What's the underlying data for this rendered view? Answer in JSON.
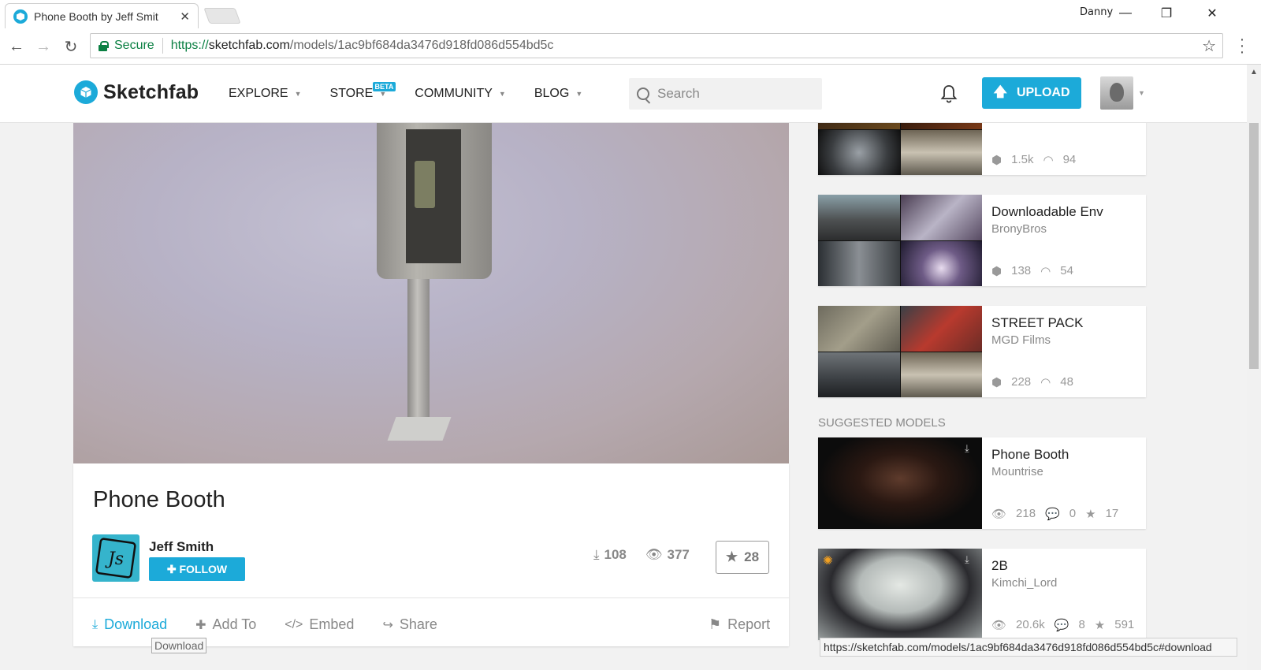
{
  "browser": {
    "tab_title": "Phone Booth by Jeff Smit",
    "window_user": "Danny",
    "secure_label": "Secure",
    "url_scheme": "https://",
    "url_host": "sketchfab.com",
    "url_path": "/models/1ac9bf684da3476d918fd086d554bd5c",
    "status_url": "https://sketchfab.com/models/1ac9bf684da3476d918fd086d554bd5c#download"
  },
  "header": {
    "logo_text": "Sketchfab",
    "nav": [
      {
        "label": "Explore"
      },
      {
        "label": "Store",
        "badge": "BETA"
      },
      {
        "label": "Community"
      },
      {
        "label": "Blog"
      }
    ],
    "search_placeholder": "Search",
    "upload_label": "UPLOAD"
  },
  "model": {
    "title": "Phone Booth",
    "author": "Jeff Smith",
    "follow_label": "FOLLOW",
    "downloads": "108",
    "views": "377",
    "likes": "28",
    "actions": {
      "download": "Download",
      "add_to": "Add To",
      "embed": "Embed",
      "share": "Share",
      "report": "Report"
    },
    "tooltip": "Download"
  },
  "sidebar": {
    "collections": [
      {
        "title": "",
        "author": "",
        "models": "1.5k",
        "followers": "94"
      },
      {
        "title": "Downloadable Env",
        "author": "BronyBros",
        "models": "138",
        "followers": "54"
      },
      {
        "title": "STREET PACK",
        "author": "MGD Films",
        "models": "228",
        "followers": "48"
      }
    ],
    "suggested_label": "Suggested models",
    "suggested": [
      {
        "title": "Phone Booth",
        "author": "Mountrise",
        "views": "218",
        "comments": "0",
        "likes": "17"
      },
      {
        "title": "2B",
        "author": "Kimchi_Lord",
        "views": "20.6k",
        "comments": "8",
        "likes": "591"
      }
    ]
  },
  "colors": {
    "brand": "#1caad9",
    "secure_green": "#0b8043"
  }
}
